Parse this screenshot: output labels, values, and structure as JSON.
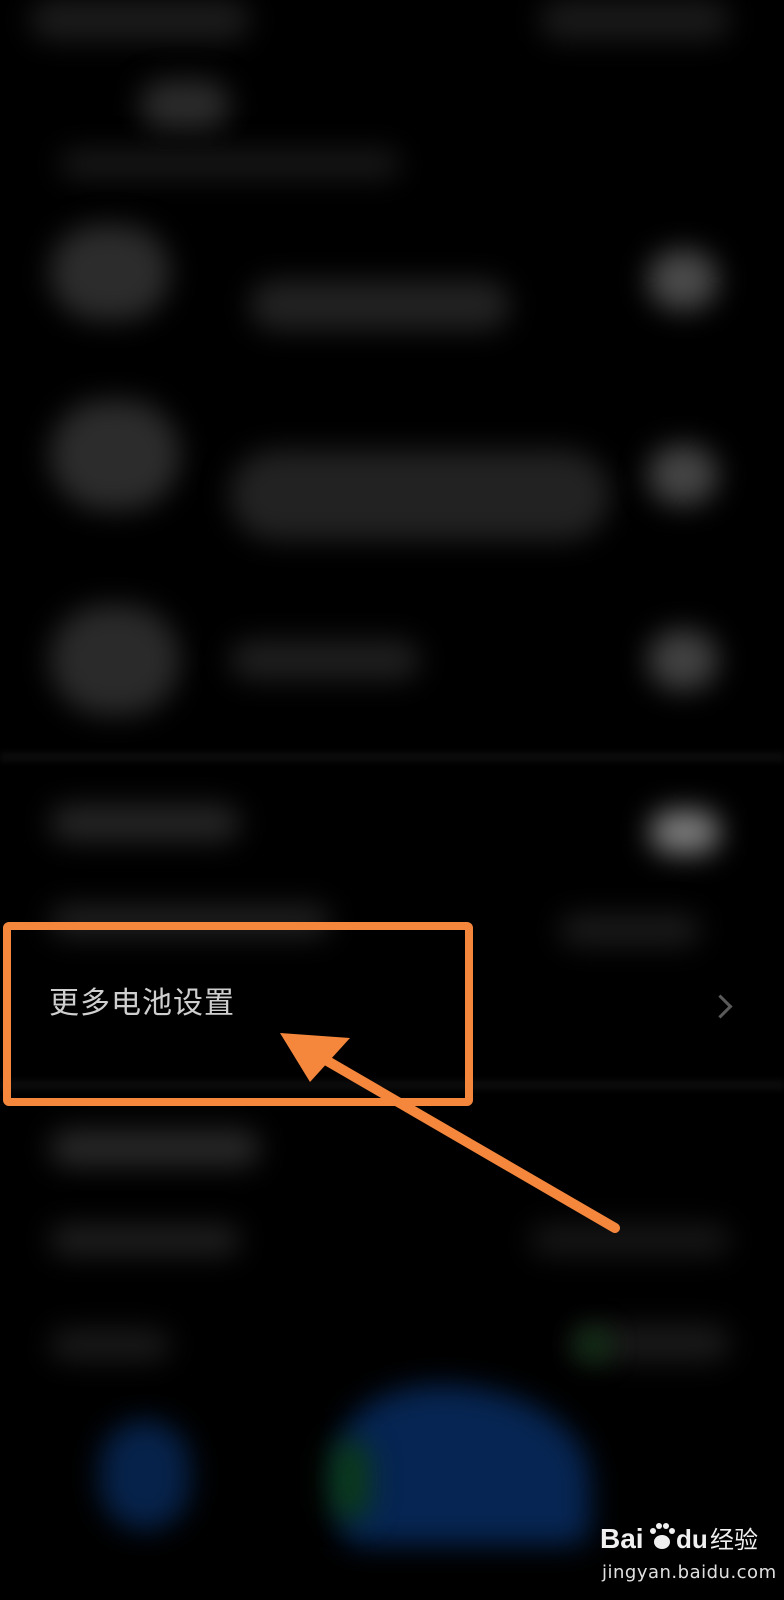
{
  "settings_list": {
    "focused_item": {
      "label": "更多电池设置",
      "chevron_icon": "chevron-right-icon"
    }
  },
  "annotation": {
    "color": "#f5873d",
    "box_icon": "highlight-rectangle",
    "arrow_icon": "pointer-arrow-icon"
  },
  "watermark": {
    "logo_text": "Bai du 经验",
    "url": "jingyan.baidu.com"
  }
}
